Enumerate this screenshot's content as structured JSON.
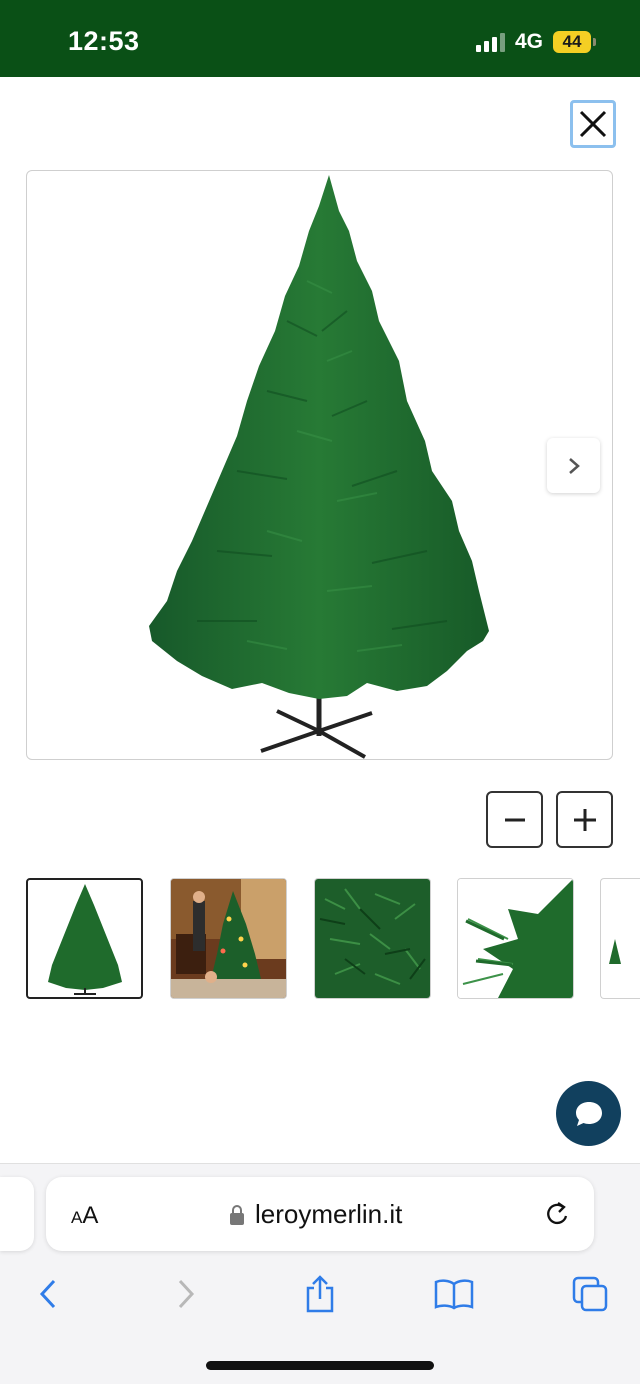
{
  "status_bar": {
    "time": "12:53",
    "network": "4G",
    "battery": "44"
  },
  "gallery": {
    "main_image_alt": "artificial christmas tree product photo",
    "thumbnails": [
      {
        "name": "thumb-tree-full",
        "active": true
      },
      {
        "name": "thumb-tree-living-room",
        "active": false
      },
      {
        "name": "thumb-branches-closeup",
        "active": false
      },
      {
        "name": "thumb-branch-detail",
        "active": false
      },
      {
        "name": "thumb-partial",
        "active": false
      }
    ]
  },
  "browser": {
    "text_size_label_small": "A",
    "text_size_label_large": "A",
    "url": "leroymerlin.it"
  },
  "colors": {
    "status_bar_bg": "#0a5016",
    "tree_green": "#1f6b2c",
    "chat_button": "#11405e",
    "accent_blue": "#2f7ce8"
  },
  "icons": {
    "close": "close-icon",
    "next": "chevron-right-icon",
    "zoom_out": "minus-icon",
    "zoom_in": "plus-icon",
    "chat": "chat-bubble-icon",
    "lock": "lock-icon",
    "reload": "reload-icon",
    "back": "chevron-left-icon",
    "forward": "chevron-right-icon",
    "share": "share-icon",
    "bookmarks": "book-icon",
    "tabs": "tabs-icon"
  }
}
